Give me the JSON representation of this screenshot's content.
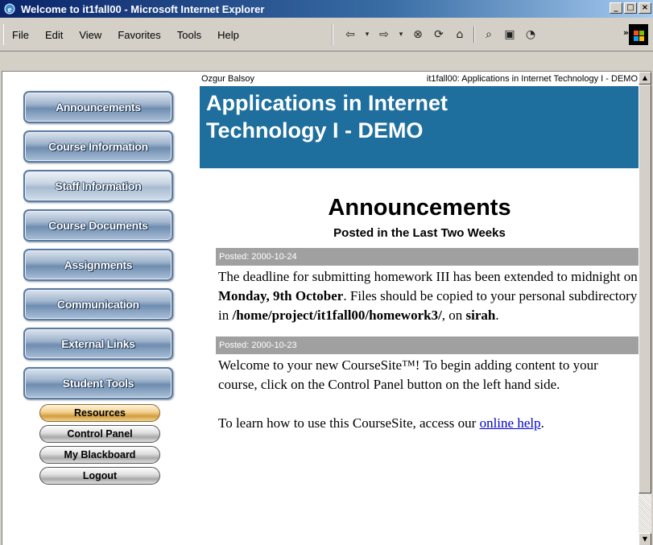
{
  "window": {
    "title": "Welcome to it1fall00 - Microsoft Internet Explorer",
    "controls": [
      "_",
      "□",
      "×"
    ]
  },
  "menu": {
    "items": [
      "File",
      "Edit",
      "View",
      "Favorites",
      "Tools",
      "Help"
    ]
  },
  "toolbar": {
    "icons": [
      "back-icon",
      "dropdown-icon",
      "forward-icon",
      "dropdown-icon",
      "stop-icon",
      "refresh-icon",
      "home-icon",
      "search-icon",
      "favorites-icon",
      "history-icon"
    ],
    "more": "»"
  },
  "nav": {
    "buttons": [
      {
        "label": "Announcements",
        "active": false
      },
      {
        "label": "Course Information",
        "active": false
      },
      {
        "label": "Staff Information",
        "active": true
      },
      {
        "label": "Course Documents",
        "active": false
      },
      {
        "label": "Assignments",
        "active": false
      },
      {
        "label": "Communication",
        "active": false
      },
      {
        "label": "External Links",
        "active": false
      },
      {
        "label": "Student Tools",
        "active": false
      }
    ],
    "pills": [
      "Resources",
      "Control Panel",
      "My Blackboard",
      "Logout"
    ]
  },
  "header": {
    "owner": "Ozgur Balsoy",
    "course": "it1fall00: Applications in Internet Technology I - DEMO",
    "banner_line1": "Applications in Internet",
    "banner_line2": "Technology I - DEMO"
  },
  "page": {
    "title": "Announcements",
    "subtitle": "Posted in the Last Two Weeks"
  },
  "announcements": [
    {
      "posted": "Posted: 2000-10-24",
      "text_1": "The deadline for submitting homework III has been extended to midnight on ",
      "bold_1": "Monday, 9th October",
      "text_2": ". Files should be copied to your personal subdirectory in ",
      "bold_2": "/home/project/it1fall00/homework3/",
      "text_3": ", on ",
      "bold_3": "sirah",
      "text_4": "."
    },
    {
      "posted": "Posted: 2000-10-23",
      "para_1": "Welcome to your new CourseSite™! To begin adding content to your course, click on the Control Panel button on the left hand side.",
      "para_2_text": "To learn how to use this CourseSite, access our ",
      "para_2_link": "online help",
      "para_2_end": "."
    }
  ],
  "colors": {
    "banner": "#1f6f9e",
    "posted_bar": "#a0a0a0",
    "link": "#0000cc"
  }
}
